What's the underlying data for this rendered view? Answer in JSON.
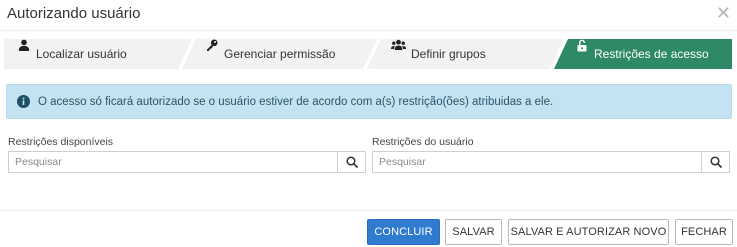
{
  "modal": {
    "title": "Autorizando usuário",
    "close_icon": "close-icon"
  },
  "wizard": {
    "steps": [
      {
        "label": "Localizar usuário",
        "icon": "user-icon",
        "active": false
      },
      {
        "label": "Gerenciar permissão",
        "icon": "key-icon",
        "active": false
      },
      {
        "label": "Definir grupos",
        "icon": "users-group-icon",
        "active": false
      },
      {
        "label": "Restrições de acesso",
        "icon": "unlock-icon",
        "active": true
      }
    ]
  },
  "alert": {
    "icon": "info-icon",
    "text": "O acesso só ficará autorizado se o usuário estiver de acordo com a(s) restrição(ões) atribuidas a ele."
  },
  "available": {
    "label": "Restrições disponíveis",
    "placeholder": "Pesquisar",
    "value": ""
  },
  "user": {
    "label": "Restrições do usuário",
    "placeholder": "Pesquisar",
    "value": ""
  },
  "buttons": {
    "conclude": "CONCLUIR",
    "save": "SALVAR",
    "save_new": "SALVAR E AUTORIZAR NOVO",
    "close": "FECHAR"
  },
  "colors": {
    "active_step": "#2e8a66",
    "inactive_step": "#f2f2f2",
    "alert_bg": "#c4e3f2",
    "primary_button": "#2f7bd0"
  }
}
